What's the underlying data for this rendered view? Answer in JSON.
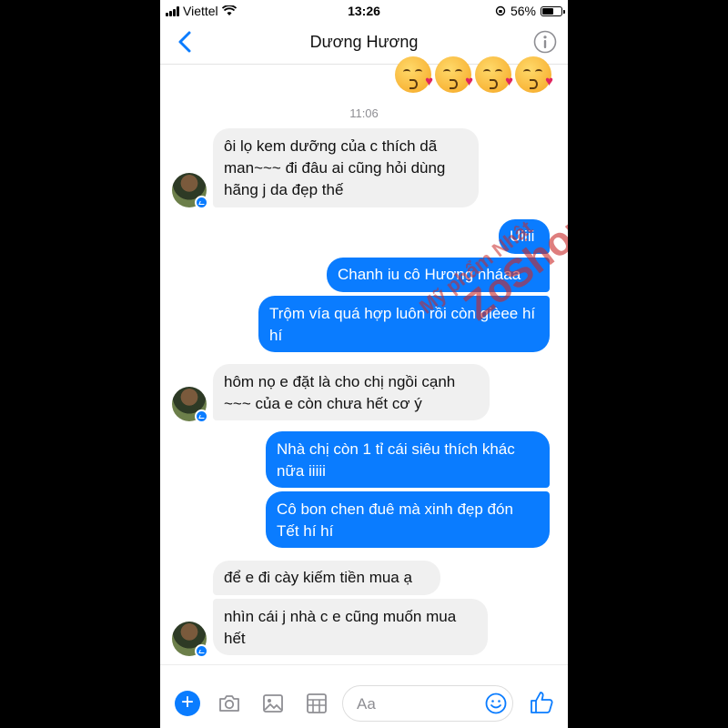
{
  "status_bar": {
    "carrier": "Viettel",
    "time": "13:26",
    "battery": "56%"
  },
  "header": {
    "contact_name": "Dương Hương"
  },
  "conversation": {
    "timestamp": "11:06",
    "messages": [
      {
        "from": "them",
        "text": "ôi lọ kem dưỡng của c thích dã man~~~ đi đâu ai cũng hỏi dùng hãng j da đẹp thế"
      },
      {
        "from": "me",
        "text": "Uiiii"
      },
      {
        "from": "me",
        "text": "Chanh  iu cô Hương nháaa"
      },
      {
        "from": "me",
        "text": "Trộm vía quá hợp luôn rồi còn gièee hí hí"
      },
      {
        "from": "them",
        "text": "hôm nọ e đặt là cho chị ngồi cạnh ~~~ của e còn chưa hết cơ ý"
      },
      {
        "from": "me",
        "text": "Nhà chị còn 1 tỉ cái siêu thích khác nữa iiiii"
      },
      {
        "from": "me",
        "text": "Cô bon chen đuê mà xinh đẹp đón Tết hí hí"
      },
      {
        "from": "them",
        "text": "để e đi cày kiếm tiền mua ạ"
      },
      {
        "from": "them",
        "text": "nhìn cái j nhà c e cũng muốn mua hết"
      }
    ]
  },
  "watermark": {
    "line1": "Mỹ phẩm Nhật",
    "line2": "ZoShop"
  },
  "composer": {
    "placeholder": "Aa"
  },
  "colors": {
    "accent": "#0a7cff",
    "incoming_bubble": "#f0f0f0"
  },
  "icons": [
    "back-chevron-icon",
    "info-icon",
    "plus-icon",
    "camera-icon",
    "gallery-icon",
    "sticker-grid-icon",
    "emoji-icon",
    "thumbs-up-icon"
  ]
}
